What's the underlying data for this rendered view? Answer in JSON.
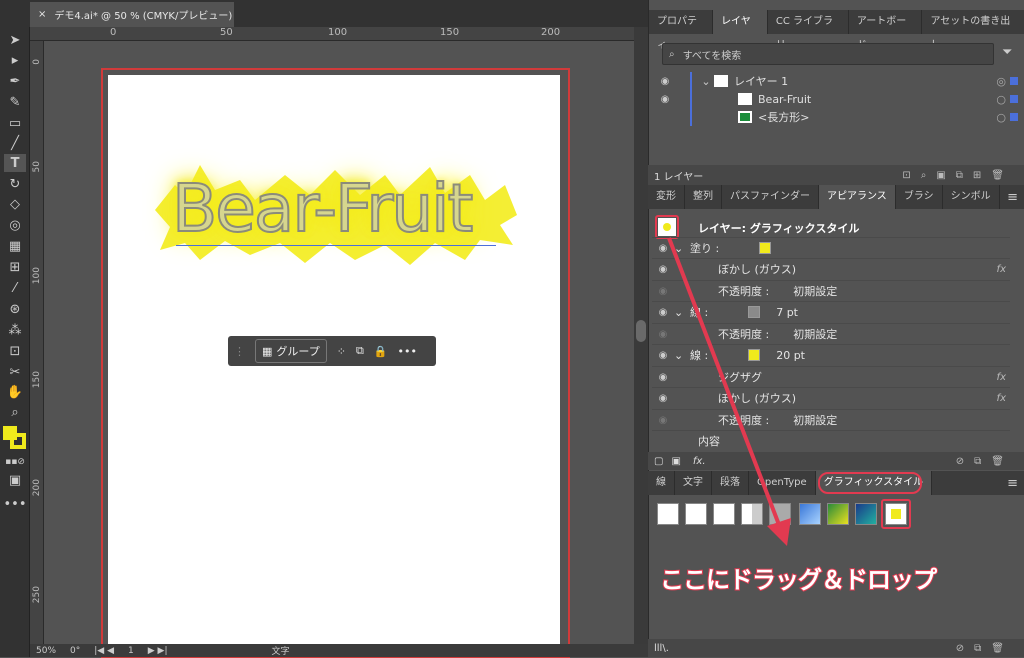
{
  "document_tab": {
    "close": "×",
    "title": "デモ4.ai* @ 50 % (CMYK/プレビュー)"
  },
  "ruler": {
    "top_ticks": [
      "0",
      "50",
      "100",
      "150",
      "200"
    ],
    "left_ticks": [
      "0",
      "50",
      "100",
      "150",
      "200",
      "250"
    ]
  },
  "artwork": {
    "title_text": "Bear-Fruit"
  },
  "context_bar": {
    "group_label": "グループ",
    "more": "•••"
  },
  "status_bar": {
    "zoom": "50%",
    "rotation": "0°",
    "artboard": "1",
    "mode": "文字"
  },
  "layers_panel": {
    "tabs": [
      "プロパティ",
      "レイヤー",
      "CC ライブラリ",
      "アートボード",
      "アセットの書き出し"
    ],
    "active_tab": 1,
    "search_placeholder": "すべてを検索",
    "rows": [
      {
        "label": "レイヤー 1",
        "level": 0
      },
      {
        "label": "Bear-Fruit",
        "level": 1
      },
      {
        "label": "<長方形>",
        "level": 1
      }
    ],
    "footer": "1 レイヤー"
  },
  "appearance_panel": {
    "tabs": [
      "変形",
      "整列",
      "パスファインダー",
      "アピアランス",
      "ブラシ",
      "シンボル"
    ],
    "active_tab": 3,
    "header": "レイヤー: グラフィックスタイル",
    "rows": [
      {
        "label": "塗り :",
        "value": "",
        "swatch": "#f0ea1c",
        "fx": false,
        "indent": 0,
        "expand": true
      },
      {
        "label": "ぼかし (ガウス)",
        "value": "",
        "fx": true,
        "indent": 1
      },
      {
        "label": "不透明度 :",
        "value": "初期設定",
        "fx": false,
        "indent": 1
      },
      {
        "label": "線 :",
        "value": "7 pt",
        "swatch": "#8a8a8a",
        "fx": false,
        "indent": 0,
        "expand": true
      },
      {
        "label": "不透明度 :",
        "value": "初期設定",
        "fx": false,
        "indent": 1
      },
      {
        "label": "線 :",
        "value": "20 pt",
        "swatch": "#f0ea1c",
        "fx": false,
        "indent": 0,
        "expand": true
      },
      {
        "label": "ジグザグ",
        "value": "",
        "fx": true,
        "indent": 1
      },
      {
        "label": "ぼかし (ガウス)",
        "value": "",
        "fx": true,
        "indent": 1
      },
      {
        "label": "不透明度 :",
        "value": "初期設定",
        "fx": false,
        "indent": 1
      },
      {
        "label": "内容",
        "value": "",
        "fx": false,
        "indent": 0
      }
    ],
    "footer_fx": "fx."
  },
  "styles_panel": {
    "tabs": [
      "線",
      "文字",
      "段落",
      "OpenType",
      "グラフィックスタイル"
    ],
    "active_tab": 4,
    "footer": "lll\\."
  },
  "annotation": {
    "callout": "ここにドラッグ＆ドロップ"
  },
  "colors": {
    "accent": "#e23a50",
    "yellow": "#f0ea1c",
    "selection_blue": "#4b6fdb"
  }
}
